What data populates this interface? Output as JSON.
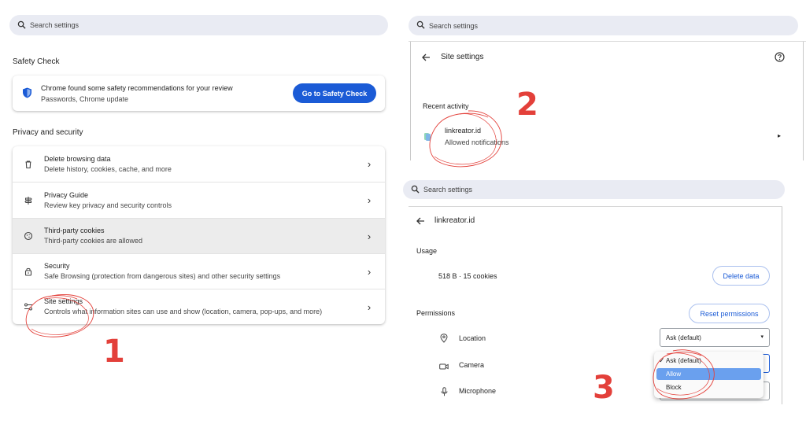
{
  "panel1": {
    "search_placeholder": "Search settings",
    "safety_check": {
      "heading": "Safety Check",
      "title": "Chrome found some safety recommendations for your review",
      "subtitle": "Passwords, Chrome update",
      "button": "Go to Safety Check"
    },
    "privacy": {
      "heading": "Privacy and security",
      "items": [
        {
          "title": "Delete browsing data",
          "subtitle": "Delete history, cookies, cache, and more",
          "icon": "trash-icon"
        },
        {
          "title": "Privacy Guide",
          "subtitle": "Review key privacy and security controls",
          "icon": "signpost-icon"
        },
        {
          "title": "Third-party cookies",
          "subtitle": "Third-party cookies are allowed",
          "icon": "cookie-icon"
        },
        {
          "title": "Security",
          "subtitle": "Safe Browsing (protection from dangerous sites) and other security settings",
          "icon": "lock-icon"
        },
        {
          "title": "Site settings",
          "subtitle": "Controls what information sites can use and show (location, camera, pop-ups, and more)",
          "icon": "sliders-icon"
        }
      ]
    },
    "step_number": "1"
  },
  "panel2": {
    "search_placeholder": "Search settings",
    "title": "Site settings",
    "recent_heading": "Recent activity",
    "site_name": "linkreator.id",
    "site_status": "Allowed notifications",
    "step_number": "2"
  },
  "panel3": {
    "search_placeholder": "Search settings",
    "title": "linkreator.id",
    "usage_heading": "Usage",
    "usage_value": "518 B · 15 cookies",
    "delete_button": "Delete data",
    "permissions_heading": "Permissions",
    "reset_button": "Reset permissions",
    "permissions": [
      {
        "label": "Location",
        "icon": "location-pin-icon"
      },
      {
        "label": "Camera",
        "icon": "camera-icon"
      },
      {
        "label": "Microphone",
        "icon": "microphone-icon"
      }
    ],
    "location_value": "Ask (default)",
    "menu_options": [
      "Ask (default)",
      "Allow",
      "Block"
    ],
    "menu_checked_index": 0,
    "menu_highlight_index": 1,
    "step_number": "3"
  },
  "colors": {
    "accent": "#1b5bd6",
    "annotation": "#e3403a",
    "highlight": "#6aa0ee"
  }
}
